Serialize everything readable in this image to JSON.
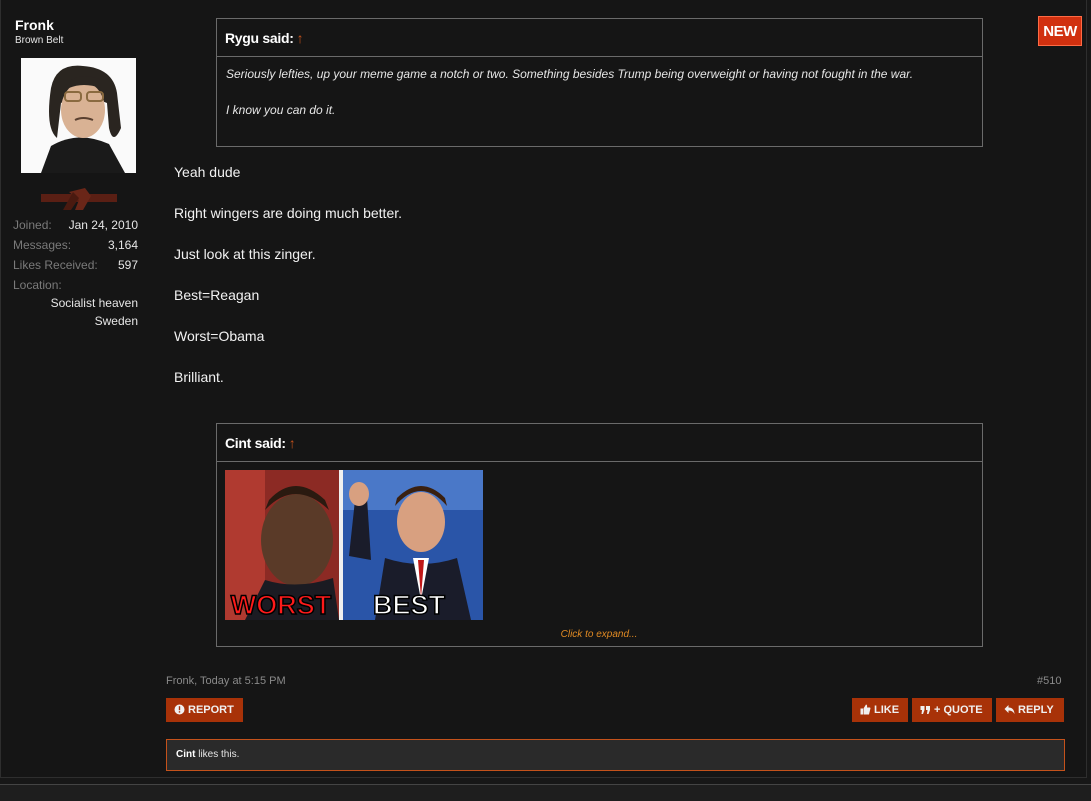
{
  "user": {
    "name": "Fronk",
    "title": "Brown Belt",
    "stats": [
      {
        "label": "Joined:",
        "value": "Jan 24, 2010"
      },
      {
        "label": "Messages:",
        "value": "3,164"
      },
      {
        "label": "Likes Received:",
        "value": "597"
      },
      {
        "label": "Location:",
        "value": ""
      }
    ],
    "location_lines": [
      "Socialist heaven",
      "Sweden"
    ]
  },
  "badge": {
    "label": "NEW",
    "color": "#d1300f"
  },
  "quote1": {
    "author": "Rygu said:",
    "arrow": "↑",
    "lines": [
      "Seriously lefties, up your meme game a notch or two. Something besides Trump being overweight or having not fought in the war.",
      "I know you can do it."
    ]
  },
  "message": {
    "lines": [
      "Yeah dude",
      "Right wingers are doing much better.",
      "Just look at this zinger.",
      "Best=Reagan",
      "Worst=Obama",
      "Brilliant."
    ]
  },
  "quote2": {
    "author": "Cint said:",
    "arrow": "↑",
    "image_captions": {
      "left": "WORST",
      "right": "BEST"
    },
    "expand": "Click to expand..."
  },
  "meta": {
    "byline": "Fronk, Today at 5:15 PM",
    "post_number": "#510"
  },
  "actions": {
    "report": "REPORT",
    "like": "LIKE",
    "quote": "+ QUOTE",
    "reply": "REPLY"
  },
  "likes": {
    "user": "Cint",
    "text": " likes this."
  },
  "colors": {
    "accent": "#a83208",
    "background": "#151515",
    "link": "#e08a23"
  }
}
